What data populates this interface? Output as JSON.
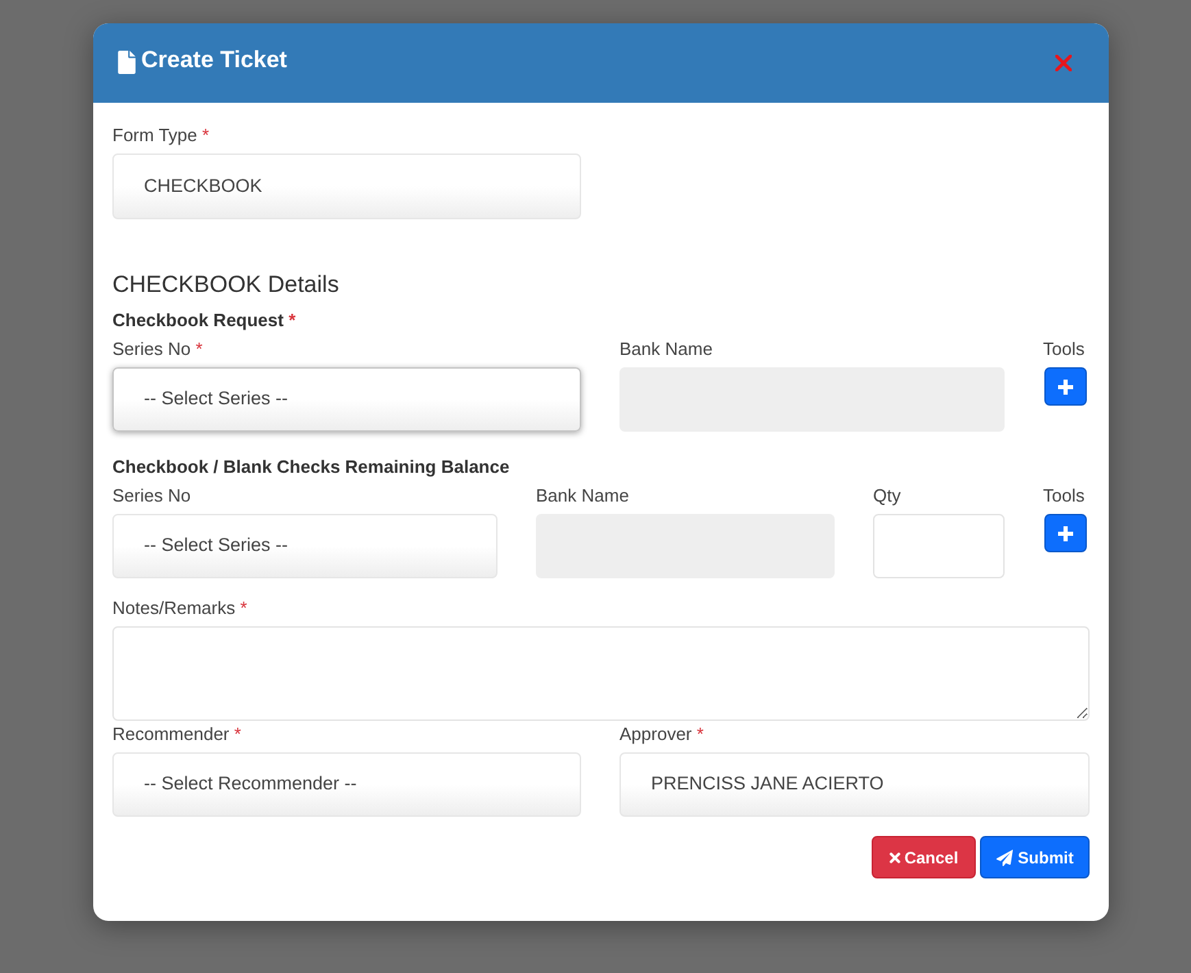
{
  "window": {
    "title": "Create Ticket"
  },
  "form_type": {
    "label": "Form Type",
    "required_mark": "*",
    "value": "CHECKBOOK"
  },
  "details": {
    "title": "CHECKBOOK Details",
    "sections": [
      {
        "title": "Checkbook Request",
        "required_mark": "*",
        "fields": [
          {
            "kind": "select",
            "label": "Series No",
            "required_mark": "*",
            "value": "-- Select Series --",
            "focused": true
          },
          {
            "kind": "readonly",
            "label": "Bank Name"
          },
          {
            "kind": "tool",
            "label": "Tools"
          }
        ]
      },
      {
        "title": "Checkbook / Blank Checks Remaining Balance",
        "fields": [
          {
            "kind": "select",
            "label": "Series No",
            "value": "-- Select Series --",
            "focused": false
          },
          {
            "kind": "readonly",
            "label": "Bank Name"
          },
          {
            "kind": "input",
            "label": "Qty"
          },
          {
            "kind": "tool",
            "label": "Tools"
          }
        ]
      }
    ]
  },
  "notes": {
    "label": "Notes/Remarks",
    "required_mark": "*"
  },
  "signatories": [
    {
      "label": "Recommender",
      "required_mark": "*",
      "value": "-- Select Recommender --"
    },
    {
      "label": "Approver",
      "required_mark": "*",
      "value": "PRENCISS JANE ACIERTO"
    }
  ],
  "buttons": [
    {
      "kind": "cancel",
      "label": "Cancel"
    },
    {
      "kind": "submit",
      "label": "Submit"
    }
  ]
}
